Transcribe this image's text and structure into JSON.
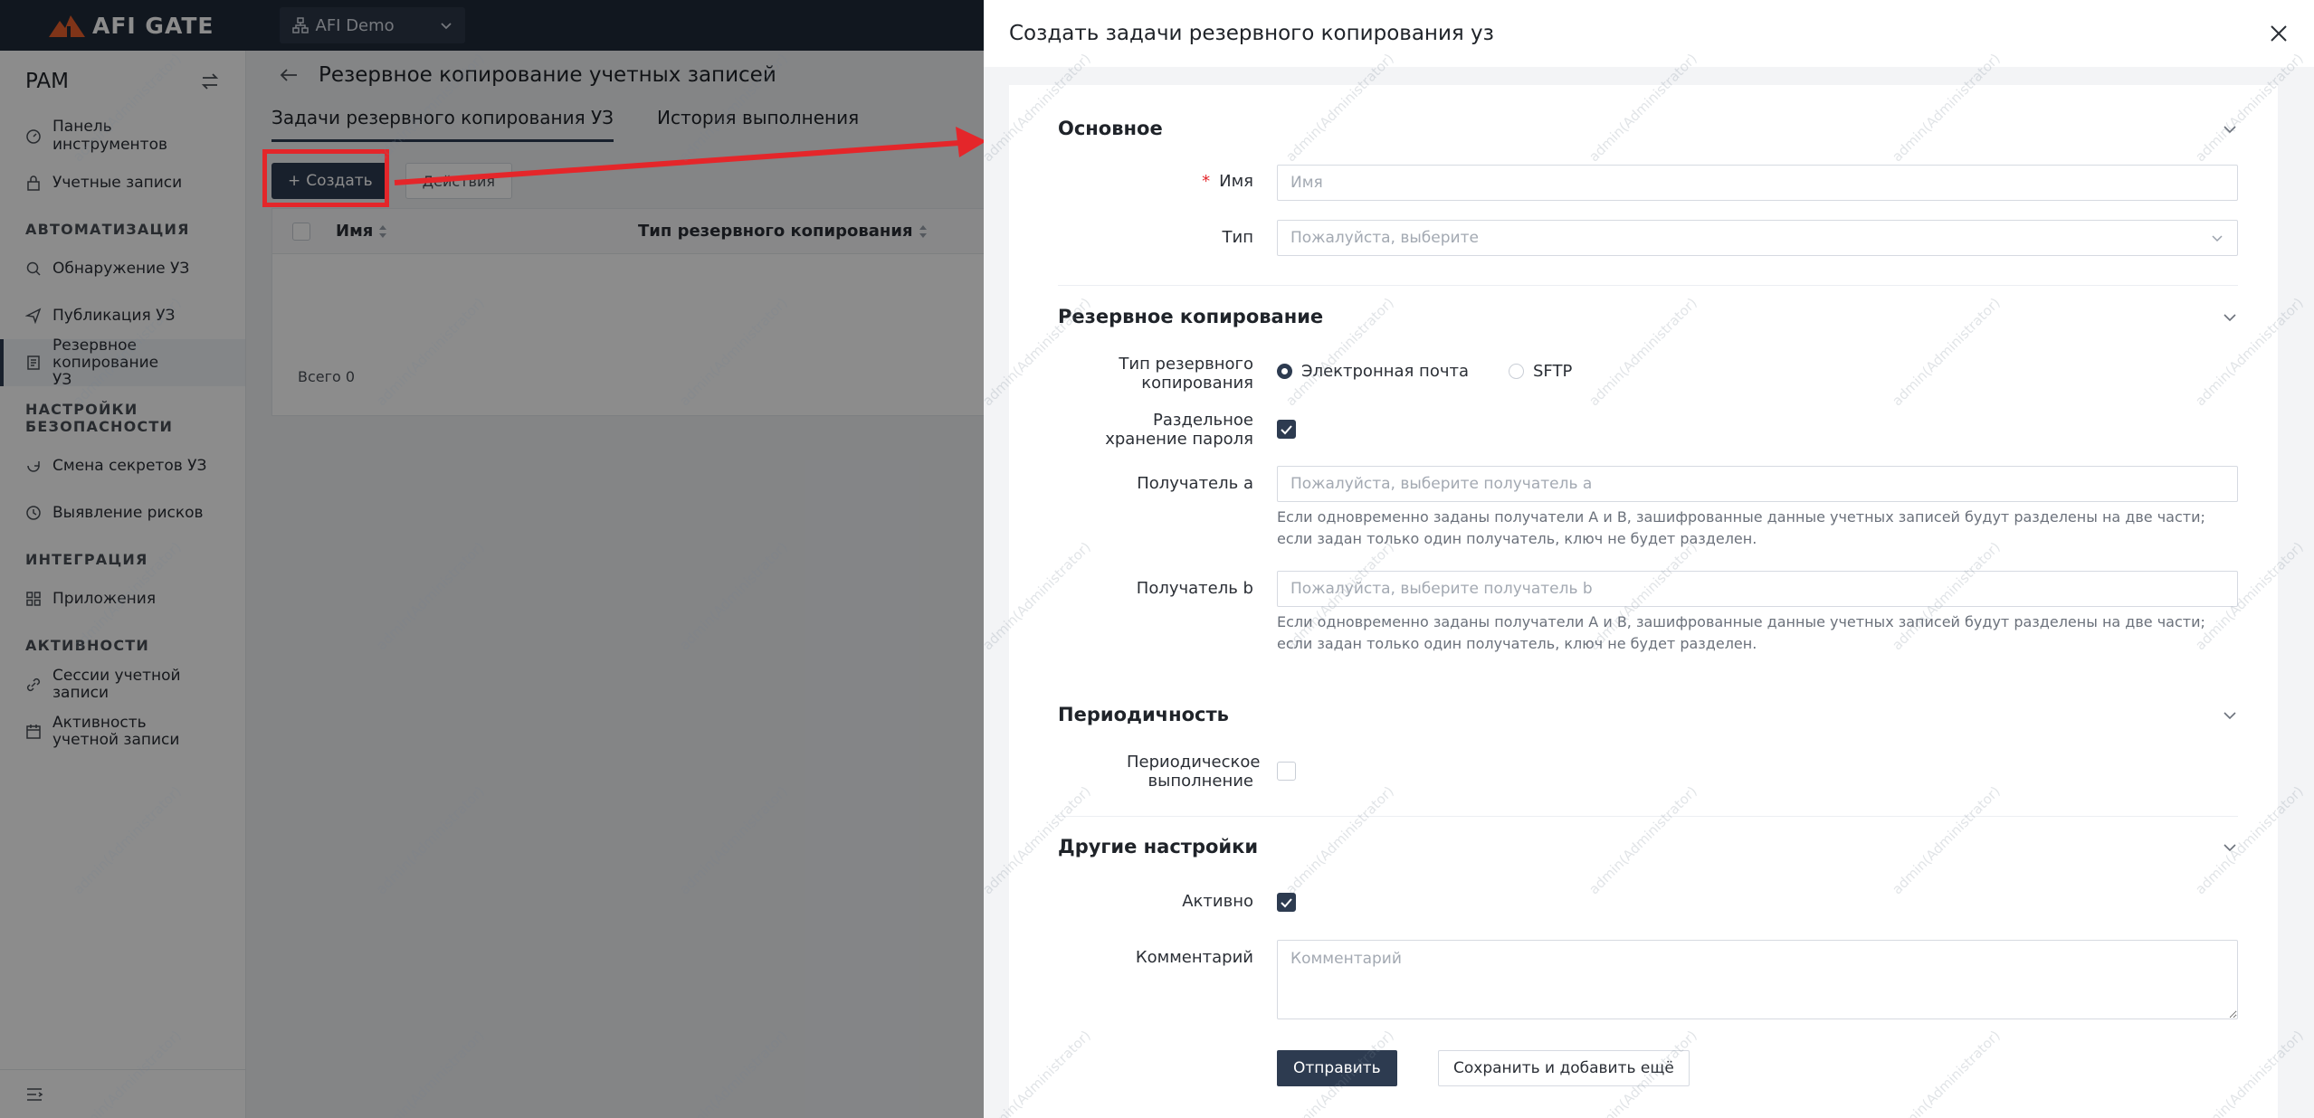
{
  "topbar": {
    "brand": "AFI GATE",
    "org": "AFI Demo"
  },
  "sidebar": {
    "title": "PAM",
    "items": [
      {
        "label": "Панель инструментов"
      },
      {
        "label": "Учетные записи"
      }
    ],
    "sections": [
      {
        "title": "АВТОМАТИЗАЦИЯ",
        "items": [
          {
            "label": "Обнаружение УЗ"
          },
          {
            "label": "Публикация УЗ"
          },
          {
            "label": "Резервное копирование УЗ"
          }
        ]
      },
      {
        "title": "НАСТРОЙКИ БЕЗОПАСНОСТИ",
        "items": [
          {
            "label": "Смена секретов УЗ"
          },
          {
            "label": "Выявление рисков"
          }
        ]
      },
      {
        "title": "ИНТЕГРАЦИЯ",
        "items": [
          {
            "label": "Приложения"
          }
        ]
      },
      {
        "title": "АКТИВНОСТИ",
        "items": [
          {
            "label": "Сессии учетной записи"
          },
          {
            "label": "Активность учетной записи"
          }
        ]
      }
    ]
  },
  "main": {
    "title": "Резервное копирование учетных записей",
    "tabs": [
      {
        "label": "Задачи резервного копирования УЗ"
      },
      {
        "label": "История выполнения"
      }
    ],
    "create_label": "Создать",
    "actions_label": "Действия",
    "table": {
      "columns": [
        "Имя",
        "Тип резервного копирования"
      ],
      "total": "Всего 0"
    }
  },
  "drawer": {
    "title": "Создать задачи резервного копирования уз",
    "sections": {
      "basic": "Основное",
      "backup": "Резервное копирование",
      "periodic": "Периодичность",
      "other": "Другие настройки"
    },
    "fields": {
      "name_label": "Имя",
      "name_placeholder": "Имя",
      "type_label": "Тип",
      "type_placeholder": "Пожалуйста, выберите",
      "backup_type_label": "Тип резервного копирования",
      "backup_type_options": [
        "Электронная почта",
        "SFTP"
      ],
      "backup_type_selected": "Электронная почта",
      "split_label": "Раздельное хранение пароля",
      "split_checked": true,
      "recipient_a_label": "Получатель a",
      "recipient_a_placeholder": "Пожалуйста, выберите получатель a",
      "recipient_b_label": "Получатель b",
      "recipient_b_placeholder": "Пожалуйста, выберите получатель b",
      "recipient_help": "Если одновременно заданы получатели А и В, зашифрованные данные учетных записей будут разделены на две части; если задан только один получатель, ключ не будет разделен.",
      "periodic_label": "Периодическое выполнение",
      "periodic_checked": false,
      "active_label": "Активно",
      "active_checked": true,
      "comment_label": "Комментарий",
      "comment_placeholder": "Комментарий"
    },
    "submit_label": "Отправить",
    "save_more_label": "Сохранить и добавить ещё"
  },
  "watermark": "admin(Administrator)",
  "colors": {
    "primary": "#2d3b50",
    "accent": "#e4262a",
    "brand": "#e8602c"
  }
}
